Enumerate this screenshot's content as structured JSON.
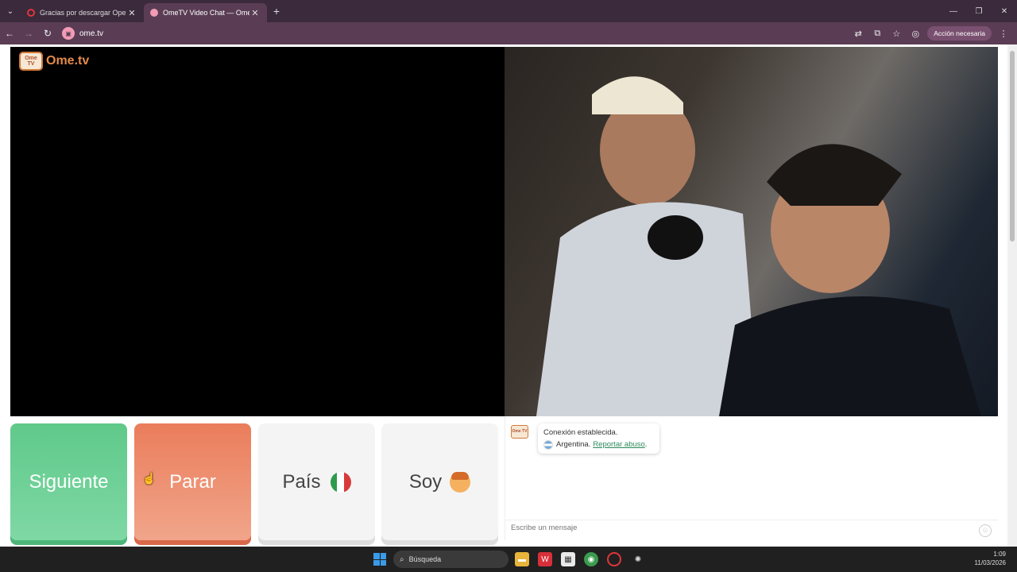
{
  "browser": {
    "tabs": [
      {
        "title": "Gracias por descargar Opera",
        "active": false,
        "favicon_color": "#e0353a"
      },
      {
        "title": "OmeTV Video Chat — Ome",
        "active": true,
        "favicon_color": "#f29bb5"
      }
    ],
    "new_tab_label": "+",
    "url": "ome.tv",
    "action_label": "Acción necesaria"
  },
  "page": {
    "logo_text": "Ome.tv",
    "logo_mark": "Ome TV",
    "buttons": {
      "next": "Siguiente",
      "stop": "Parar",
      "country": "País",
      "gender": "Soy"
    },
    "chat": {
      "status": "Conexión establecida.",
      "country": "Argentina.",
      "report_link": "Reportar abuso",
      "report_suffix": ".",
      "input_placeholder": "Escribe un mensaje"
    }
  },
  "taskbar": {
    "search_label": "Búsqueda",
    "time": "1:09",
    "date": "11/03/2026"
  },
  "colors": {
    "next_button": "#5fc98a",
    "stop_button": "#ea7d5b",
    "report_link": "#2d8a5c"
  }
}
